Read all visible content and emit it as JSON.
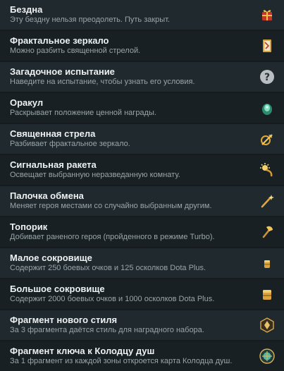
{
  "items": [
    {
      "title": "Бездна",
      "desc": "Эту бездну нельзя преодолеть. Путь закрыт.",
      "icon": "ribbon-gift-icon"
    },
    {
      "title": "Фрактальное зеркало",
      "desc": "Можно разбить священной стрелой.",
      "icon": "mirror-icon"
    },
    {
      "title": "Загадочное испытание",
      "desc": "Наведите на испытание, чтобы узнать его условия.",
      "icon": "question-icon"
    },
    {
      "title": "Оракул",
      "desc": "Раскрывает положение ценной награды.",
      "icon": "oracle-icon"
    },
    {
      "title": "Священная стрела",
      "desc": "Разбивает фрактальное зеркало.",
      "icon": "arrow-icon"
    },
    {
      "title": "Сигнальная ракета",
      "desc": "Освещает выбранную неразведанную комнату.",
      "icon": "flare-icon"
    },
    {
      "title": "Палочка обмена",
      "desc": "Меняет героя местами со случайно выбранным другим.",
      "icon": "wand-icon"
    },
    {
      "title": "Топорик",
      "desc": "Добивает раненого героя (пройденного в режиме Turbo).",
      "icon": "hatchet-icon"
    },
    {
      "title": "Малое сокровище",
      "desc": "Содержит 250 боевых очков и 125 осколков Dota Plus.",
      "icon": "small-treasure-icon"
    },
    {
      "title": "Большое сокровище",
      "desc": "Содержит 2000 боевых очков и 1000 осколков Dota Plus.",
      "icon": "large-treasure-icon"
    },
    {
      "title": "Фрагмент нового стиля",
      "desc": "За 3 фрагмента даётся стиль для наградного набора.",
      "icon": "style-fragment-icon"
    },
    {
      "title": "Фрагмент ключа к Колодцу душ",
      "desc": "За 1 фрагмент из каждой зоны откроется карта Колодца душ.",
      "icon": "key-fragment-icon"
    }
  ]
}
